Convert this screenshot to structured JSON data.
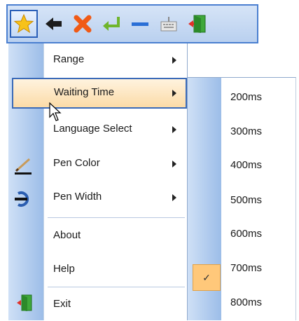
{
  "toolbar": {
    "buttons": [
      {
        "icon": "star-icon",
        "active": true
      },
      {
        "icon": "back-arrow-icon"
      },
      {
        "icon": "close-icon"
      },
      {
        "icon": "enter-icon"
      },
      {
        "icon": "minimize-icon"
      },
      {
        "icon": "keyboard-icon"
      },
      {
        "icon": "exit-door-icon"
      }
    ]
  },
  "menu": {
    "items": [
      {
        "label": "Range",
        "submenu": true
      },
      {
        "label": "Waiting Time",
        "submenu": true,
        "highlighted": true
      },
      {
        "label": "Language Select",
        "submenu": true
      },
      {
        "label": "Pen Color",
        "submenu": true,
        "icon": "pen-color-icon"
      },
      {
        "label": "Pen Width",
        "submenu": true,
        "icon": "pen-width-icon"
      },
      {
        "label": "About"
      },
      {
        "label": "Help"
      },
      {
        "label": "Exit",
        "icon": "exit-door-icon"
      }
    ]
  },
  "submenu": {
    "items": [
      {
        "label": "200ms"
      },
      {
        "label": "300ms"
      },
      {
        "label": "400ms"
      },
      {
        "label": "500ms",
        "checked": true
      },
      {
        "label": "600ms"
      },
      {
        "label": "700ms"
      },
      {
        "label": "800ms"
      }
    ],
    "check_mark": "✓"
  },
  "colors": {
    "toolbar_bg": "#c6daf3",
    "highlight": "#fbdba7",
    "check_bg": "#ffc87a",
    "menu_border": "#3a6ab8"
  }
}
